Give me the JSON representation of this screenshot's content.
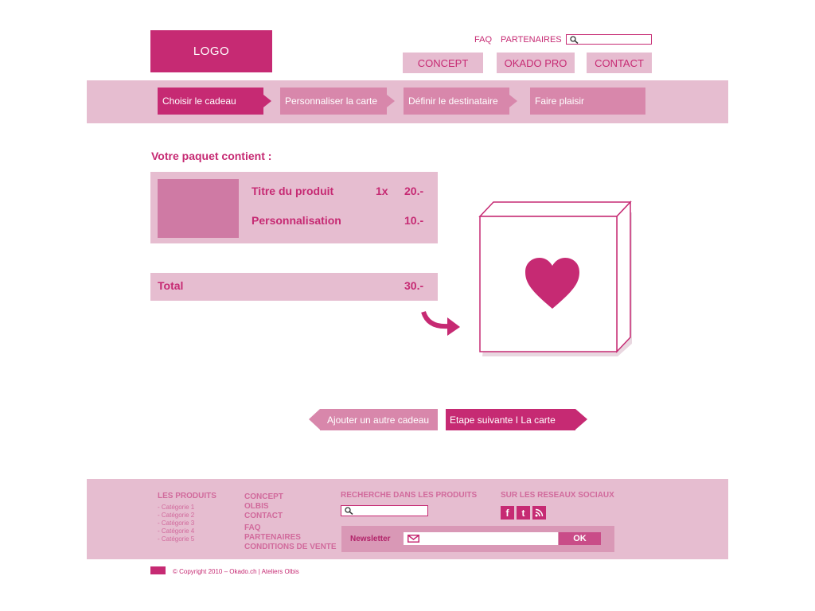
{
  "header": {
    "logo": "LOGO",
    "links": {
      "faq": "FAQ",
      "partners": "PARTENAIRES"
    },
    "search_placeholder": "",
    "nav": [
      "CONCEPT",
      "OKADO PRO",
      "CONTACT"
    ]
  },
  "steps": [
    {
      "label": "Choisir le cadeau",
      "state": "active"
    },
    {
      "label": "Personnaliser la carte",
      "state": "inactive"
    },
    {
      "label": "Définir le destinataire",
      "state": "inactive"
    },
    {
      "label": "Faire plaisir",
      "state": "inactive"
    }
  ],
  "package": {
    "title": "Votre paquet contient :",
    "product": {
      "name": "Titre du produit",
      "qty": "1x",
      "price": "20.-"
    },
    "personalisation": {
      "name": "Personnalisation",
      "price": "10.-"
    },
    "total": {
      "label": "Total",
      "value": "30.-"
    }
  },
  "buttons": {
    "add_gift": "Ajouter un autre cadeau",
    "next_step": "Etape suivante I La carte"
  },
  "footer": {
    "products_heading": "LES PRODUITS",
    "categories": [
      "- Catégorie 1",
      "- Catégorie 2",
      "- Catégorie 3",
      "- Catégorie 4",
      "- Catégorie 5"
    ],
    "links": [
      "CONCEPT",
      "OLBIS",
      "CONTACT",
      "FAQ",
      "PARTENAIRES",
      "CONDITIONS DE VENTE"
    ],
    "search_heading": "RECHERCHE DANS LES PRODUITS",
    "social_heading": "SUR LES RESEAUX SOCIAUX",
    "social_icons": [
      "facebook-icon",
      "twitter-icon",
      "rss-icon"
    ],
    "newsletter_label": "Newsletter",
    "ok_label": "OK",
    "copyright": "© Copyright 2010 – Okado.ch | Ateliers Olbis"
  },
  "colors": {
    "primary": "#c62a73",
    "light": "#e6bdd0",
    "medium": "#cf7aa4",
    "step_inactive": "#d887ab"
  }
}
